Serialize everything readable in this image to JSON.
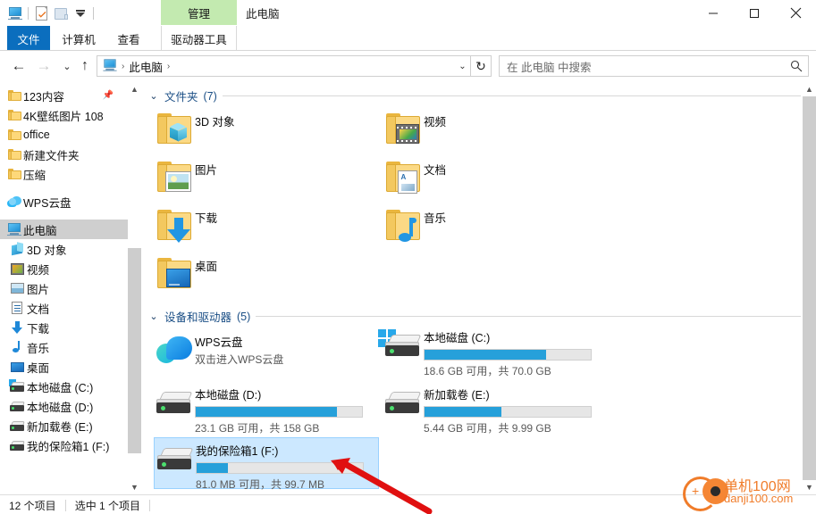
{
  "window": {
    "title": "此电脑",
    "contextual_tab": "管理",
    "quick_access": [
      "this-pc-icon",
      "properties-icon",
      "new-folder-icon",
      "customize-dropdown-icon"
    ],
    "controls": {
      "minimize": "—",
      "maximize": "□",
      "close": "✕"
    },
    "ribbon_collapse": "⌄",
    "help": "?"
  },
  "ribbon": {
    "tabs": [
      {
        "label": "文件",
        "active": true
      },
      {
        "label": "计算机",
        "active": false
      },
      {
        "label": "查看",
        "active": false
      },
      {
        "label": "驱动器工具",
        "active": false
      }
    ]
  },
  "navigation": {
    "back": "←",
    "forward": "→",
    "history": "⌄",
    "up": "↑",
    "breadcrumb": {
      "icon": "this-pc-icon",
      "text": "此电脑",
      "sep": "›"
    },
    "address_dropdown": "⌄",
    "refresh": "↻"
  },
  "search": {
    "placeholder": "在 此电脑 中搜索",
    "icon": "search-icon"
  },
  "sidebar": {
    "quick_access": [
      {
        "label": "123内容",
        "icon": "folder-icon",
        "pinned": true
      },
      {
        "label": "4K壁纸图片 108",
        "icon": "folder-icon",
        "pinned": false
      },
      {
        "label": "office",
        "icon": "folder-icon",
        "pinned": false
      },
      {
        "label": "新建文件夹",
        "icon": "folder-icon",
        "pinned": false
      },
      {
        "label": "压缩",
        "icon": "folder-icon",
        "pinned": false
      }
    ],
    "cloud": {
      "label": "WPS云盘",
      "icon": "cloud-icon"
    },
    "this_pc": {
      "label": "此电脑",
      "icon": "this-pc-icon",
      "selected": true
    },
    "this_pc_children": [
      {
        "label": "3D 对象",
        "icon": "3d-objects-icon"
      },
      {
        "label": "视频",
        "icon": "videos-icon"
      },
      {
        "label": "图片",
        "icon": "pictures-icon"
      },
      {
        "label": "文档",
        "icon": "documents-icon"
      },
      {
        "label": "下载",
        "icon": "downloads-icon"
      },
      {
        "label": "音乐",
        "icon": "music-icon"
      },
      {
        "label": "桌面",
        "icon": "desktop-icon"
      },
      {
        "label": "本地磁盘 (C:)",
        "icon": "drive-icon"
      },
      {
        "label": "本地磁盘 (D:)",
        "icon": "drive-icon"
      },
      {
        "label": "新加载卷 (E:)",
        "icon": "drive-icon"
      },
      {
        "label": "我的保险箱1 (F:)",
        "icon": "drive-icon"
      }
    ]
  },
  "main": {
    "groups": [
      {
        "title": "文件夹",
        "count": "(7)",
        "expander": "⌄"
      },
      {
        "title": "设备和驱动器",
        "count": "(5)",
        "expander": "⌄"
      }
    ],
    "folders": [
      {
        "name": "3D 对象",
        "icon": "folder-3d-objects-icon"
      },
      {
        "name": "视频",
        "icon": "folder-videos-icon"
      },
      {
        "name": "图片",
        "icon": "folder-pictures-icon"
      },
      {
        "name": "文档",
        "icon": "folder-documents-icon"
      },
      {
        "name": "下载",
        "icon": "folder-downloads-icon"
      },
      {
        "name": "音乐",
        "icon": "folder-music-icon"
      },
      {
        "name": "桌面",
        "icon": "folder-desktop-icon"
      }
    ],
    "drives": [
      {
        "name": "WPS云盘",
        "icon": "wps-cloud-icon",
        "subtitle": "双击进入WPS云盘",
        "has_bar": false,
        "selected": false
      },
      {
        "name": "本地磁盘 (C:)",
        "icon": "windows-drive-icon",
        "usage": "18.6 GB 可用，共 70.0 GB",
        "has_bar": true,
        "fill_percent": 73,
        "free": "18.6 GB",
        "total": "70.0 GB",
        "selected": false
      },
      {
        "name": "本地磁盘 (D:)",
        "icon": "drive-icon",
        "usage": "23.1 GB 可用，共 158 GB",
        "has_bar": true,
        "fill_percent": 85,
        "free": "23.1 GB",
        "total": "158 GB",
        "selected": false
      },
      {
        "name": "新加载卷 (E:)",
        "icon": "drive-icon",
        "usage": "5.44 GB 可用，共 9.99 GB",
        "has_bar": true,
        "fill_percent": 46,
        "free": "5.44 GB",
        "total": "9.99 GB",
        "selected": false
      },
      {
        "name": "我的保险箱1 (F:)",
        "icon": "drive-icon",
        "usage": "81.0 MB 可用，共 99.7 MB",
        "has_bar": true,
        "fill_percent": 19,
        "free": "81.0 MB",
        "total": "99.7 MB",
        "selected": true
      }
    ]
  },
  "status": {
    "item_count": "12 个项目",
    "selection": "选中 1 个项目"
  },
  "watermark": {
    "line1": "单机100网",
    "line2": "danji100.com",
    "color": "#f07c2a"
  },
  "colors": {
    "accent": "#0b6ebe",
    "bar_fill": "#26a0da",
    "selection": "#cce8ff",
    "contextual_tab": "#c3eab0",
    "annotation": "#e01010"
  }
}
